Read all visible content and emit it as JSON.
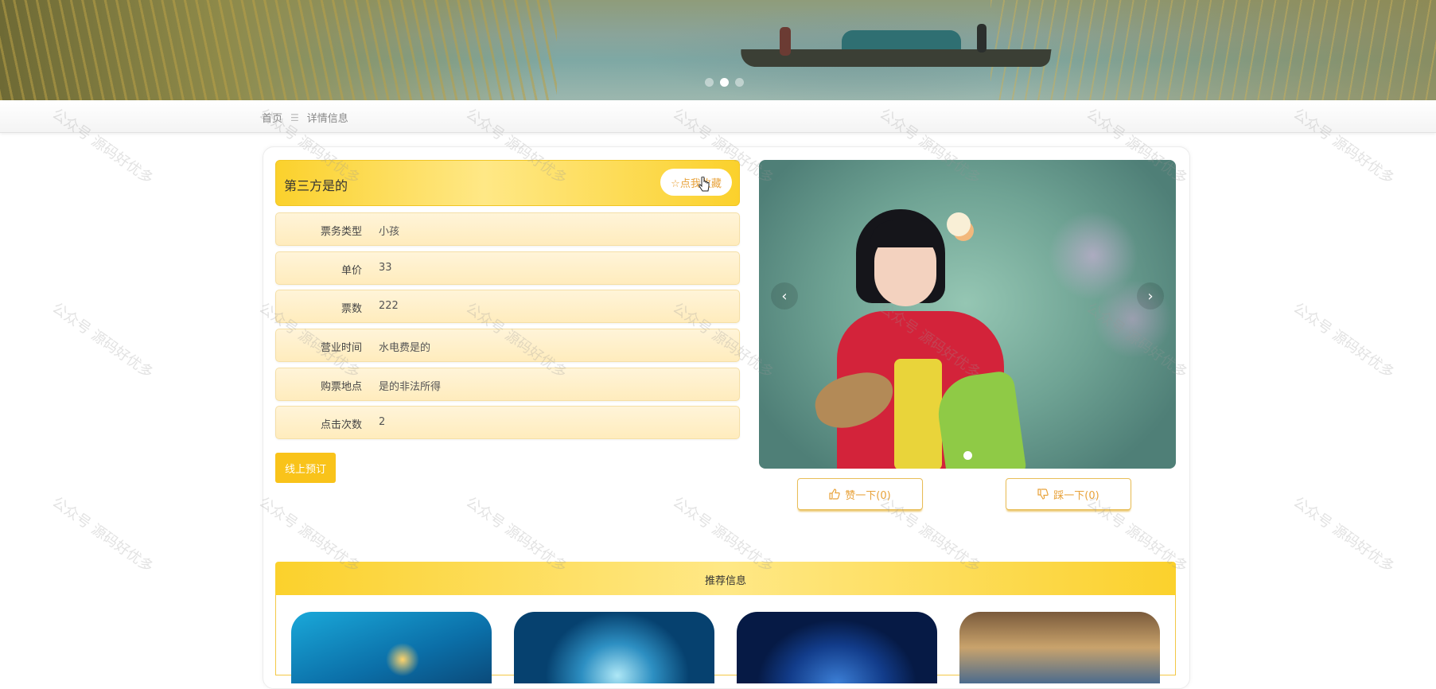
{
  "carousel": {
    "slide_count": 3,
    "active_index": 1
  },
  "breadcrumb": {
    "home": "首页",
    "separator": "☰",
    "current": "详情信息"
  },
  "detail": {
    "title": "第三方是的",
    "favorite_label": "☆点我收藏",
    "fields": [
      {
        "label": "票务类型",
        "value": "小孩"
      },
      {
        "label": "单价",
        "value": "33"
      },
      {
        "label": "票数",
        "value": "222"
      },
      {
        "label": "营业时间",
        "value": "水电费是的"
      },
      {
        "label": "购票地点",
        "value": "是的非法所得"
      },
      {
        "label": "点击次数",
        "value": "2"
      }
    ],
    "book_label": "线上预订"
  },
  "gallery": {
    "prev_icon": "‹",
    "next_icon": "›",
    "slide_count": 1,
    "active_index": 0
  },
  "votes": {
    "like_label": "赞一下(0)",
    "dislike_label": "踩一下(0)",
    "like_icon": "thumbs-up-icon",
    "dislike_icon": "thumbs-down-icon"
  },
  "recommend": {
    "title": "推荐信息"
  },
  "watermark": "公众号 源码好优多",
  "colors": {
    "accent": "#fbd12c",
    "accent_text": "#e8a23a",
    "row_bg": "#ffecbd"
  }
}
